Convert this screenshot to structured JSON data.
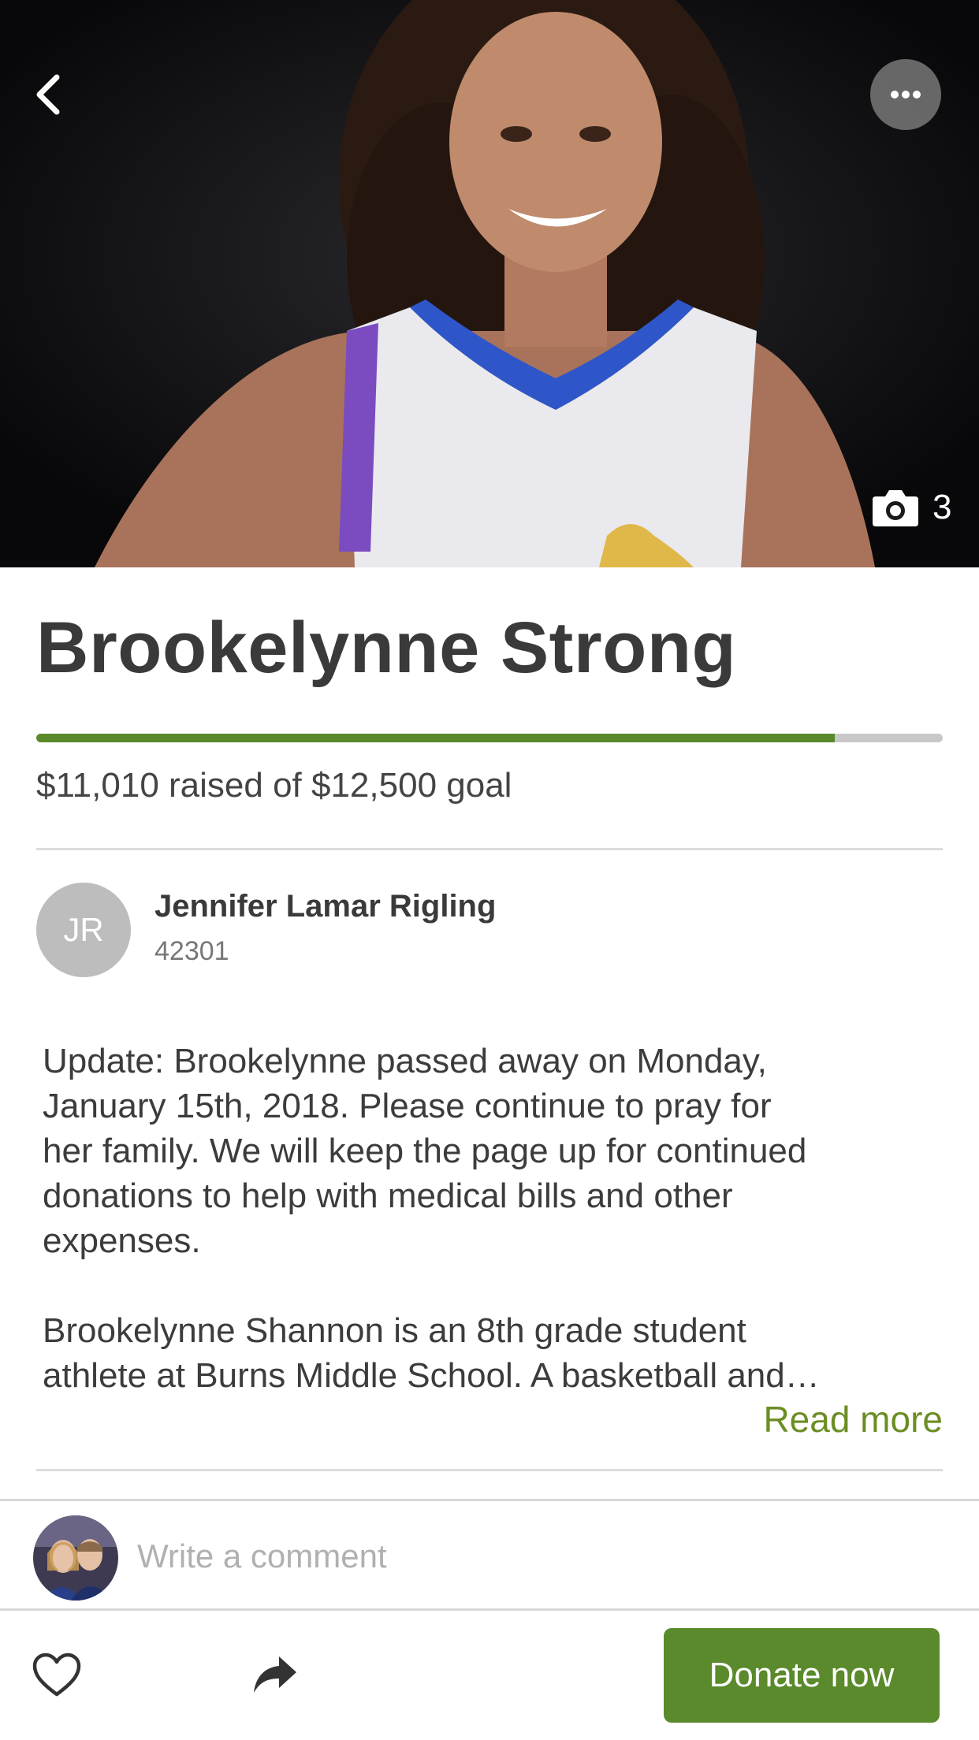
{
  "hero": {
    "photo_count": "3",
    "icons": {
      "back": "chevron-left-icon",
      "more": "more-dots-icon",
      "camera": "camera-icon"
    }
  },
  "campaign": {
    "title": "Brookelynne Strong",
    "raised_text": "$11,010 raised of $12,500 goal",
    "progress_fraction": 0.8808
  },
  "organizer": {
    "initials": "JR",
    "name": "Jennifer Lamar Rigling",
    "location": "42301"
  },
  "story": {
    "paragraph_1": "Update: Brookelynne passed away on Monday,\nJanuary 15th, 2018. Please continue to pray for\nher family. We will keep the page up for continued\ndonations to help with medical bills and other\nexpenses.",
    "paragraph_2": "Brookelynne Shannon is an 8th grade student\nathlete at Burns Middle School. A basketball and…",
    "read_more": "Read more"
  },
  "comment": {
    "placeholder": "Write a comment"
  },
  "actions": {
    "donate_label": "Donate now",
    "icons": {
      "like": "heart-icon",
      "share": "share-arrow-icon"
    }
  },
  "colors": {
    "accent_green": "#5a8a2b",
    "read_more_green": "#6b8e23",
    "progress_track": "#c8c8c8"
  }
}
